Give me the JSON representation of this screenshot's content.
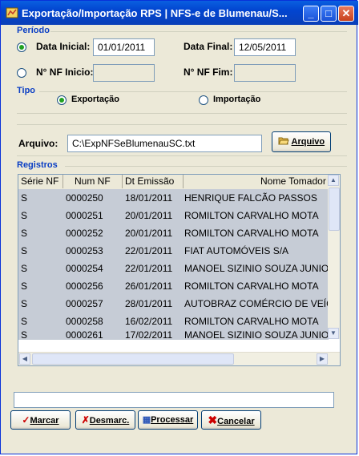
{
  "window": {
    "title": "Exportação/Importação RPS   |   NFS-e de Blumenau/S...",
    "minimize": "_",
    "maximize": "□",
    "close": "✕"
  },
  "periodo": {
    "group_title": "Período",
    "data_inicial_label": "Data Inicial:",
    "data_inicial_value": "01/01/2011",
    "data_final_label": "Data Final:",
    "data_final_value": "12/05/2011",
    "nf_inicio_label": "N° NF Inicio:",
    "nf_inicio_value": "",
    "nf_fim_label": "N° NF Fim:",
    "nf_fim_value": "",
    "selected": "data"
  },
  "tipo": {
    "group_title": "Tipo",
    "exportacao_label": "Exportação",
    "importacao_label": "Importação",
    "selected": "exportacao"
  },
  "arquivo": {
    "label": "Arquivo:",
    "value": "C:\\ExpNFSeBlumenauSC.txt",
    "button_label": "Arquivo"
  },
  "registros": {
    "group_title": "Registros",
    "columns": [
      "Série NF",
      "Num NF",
      "Dt Emissão",
      "Nome Tomador"
    ],
    "rows": [
      [
        "S",
        "0000250",
        "18/01/2011",
        "HENRIQUE FALCÃO PASSOS"
      ],
      [
        "S",
        "0000251",
        "20/01/2011",
        "ROMILTON CARVALHO MOTA"
      ],
      [
        "S",
        "0000252",
        "20/01/2011",
        "ROMILTON CARVALHO MOTA"
      ],
      [
        "S",
        "0000253",
        "22/01/2011",
        "FIAT AUTOMÓVEIS S/A"
      ],
      [
        "S",
        "0000254",
        "22/01/2011",
        "MANOEL SIZINIO SOUZA JUNIOR"
      ],
      [
        "S",
        "0000256",
        "26/01/2011",
        "ROMILTON CARVALHO MOTA"
      ],
      [
        "S",
        "0000257",
        "28/01/2011",
        "AUTOBRAZ COMÉRCIO DE VEÍCULOS"
      ],
      [
        "S",
        "0000258",
        "16/02/2011",
        "ROMILTON CARVALHO MOTA"
      ],
      [
        "S",
        "0000261",
        "17/02/2011",
        "MANOEL SIZINIO SOUZA JUNIOR"
      ]
    ]
  },
  "status_bar": {
    "value": ""
  },
  "buttons": {
    "marcar": "Marcar",
    "desmarc": "Desmarc.",
    "processar": "Processar",
    "cancelar": "Cancelar"
  },
  "colors": {
    "title_blue": "#0245d0",
    "group_title": "#0a3ec4",
    "row_selected": "#c6ccd6",
    "radio_on": "#21a121",
    "cancel_x": "#cc0000"
  }
}
